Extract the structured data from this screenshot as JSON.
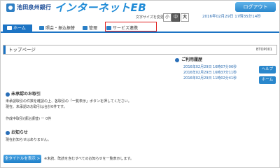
{
  "header": {
    "bank_name": "池田泉州銀行",
    "service_title": "インターネットEB",
    "logout_label": "ログアウト",
    "font_size_label": "文字サイズを変更",
    "font_sizes": [
      "小",
      "中",
      "大"
    ],
    "datetime": "2016年02月29日 17時35分14秒"
  },
  "nav": {
    "tabs": [
      {
        "label": "ホーム",
        "icon": "home-icon"
      },
      {
        "label": "照会・振込振替",
        "icon": "document-icon"
      },
      {
        "label": "管理",
        "icon": "folder-icon"
      },
      {
        "label": "サービス連携",
        "icon": "link-icon"
      }
    ]
  },
  "page": {
    "title": "トップページ",
    "page_id": "BTOP001"
  },
  "history": {
    "title": "ご利用履歴",
    "entries": [
      "2016年02月29日 16時07分06秒",
      "2016年02月29日 16時37分11秒",
      "2016年02月29日 11時02分41秒"
    ]
  },
  "side": {
    "help_label": "ヘルプ",
    "home_label": "ホーム"
  },
  "unapproved": {
    "title": "未承認のお取引",
    "lines": [
      "未承認取引の件数を確認の上、各取引の「一覧表示」ボタンを押してください。",
      "現在、未承認のお取引は合計0件です。",
      "",
      "作成中取引(振込振替) ー 0件"
    ]
  },
  "notices": {
    "title": "お知らせ",
    "empty_message": "現在お知らせはありません。",
    "all_titles_button": "全タイトルを表示 >",
    "all_titles_note": "※未読、既読を含むすべてのお知らせを一覧表示します。"
  }
}
